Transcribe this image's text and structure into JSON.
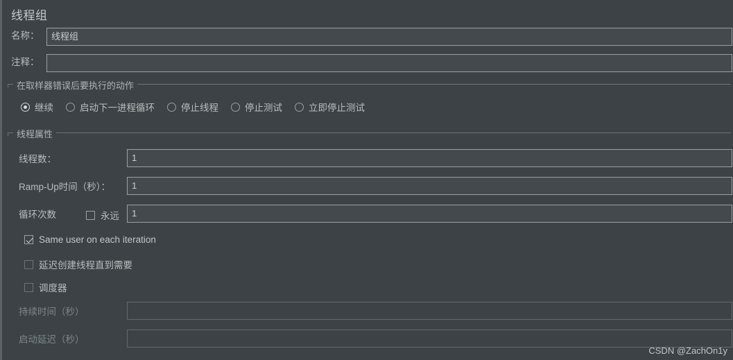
{
  "panel": {
    "title": "线程组",
    "watermark": "CSDN @ZachOn1y",
    "colors": {
      "background": "#3c4245",
      "field_background": "#43494c",
      "field_border": "#9aa0a3",
      "text": "#b9bdbf",
      "text_disabled": "#7e8689",
      "group_border": "#6e7578"
    }
  },
  "name_field": {
    "label": "名称：",
    "value": "线程组"
  },
  "comment_field": {
    "label": "注释：",
    "value": ""
  },
  "error_action_group": {
    "title": "在取样器错误后要执行的动作",
    "options": [
      {
        "label": "继续",
        "selected": true
      },
      {
        "label": "启动下一进程循环",
        "selected": false
      },
      {
        "label": "停止线程",
        "selected": false
      },
      {
        "label": "停止测试",
        "selected": false
      },
      {
        "label": "立即停止测试",
        "selected": false
      }
    ]
  },
  "thread_properties_group": {
    "title": "线程属性",
    "thread_count": {
      "label": "线程数：",
      "value": "1"
    },
    "ramp_up": {
      "label": "Ramp-Up时间（秒）：",
      "value": "1"
    },
    "loop_count": {
      "label": "循环次数",
      "forever_label": "永远",
      "forever_checked": false,
      "value": "1"
    },
    "same_user": {
      "label": "Same user on each iteration",
      "checked": true
    },
    "delay_thread_creation": {
      "label": "延迟创建线程直到需要",
      "checked": false
    },
    "scheduler": {
      "label": "调度器",
      "checked": false
    },
    "duration": {
      "label": "持续时间（秒）",
      "value": "",
      "disabled": true
    },
    "startup_delay": {
      "label": "启动延迟（秒）",
      "value": "",
      "disabled": true
    }
  }
}
